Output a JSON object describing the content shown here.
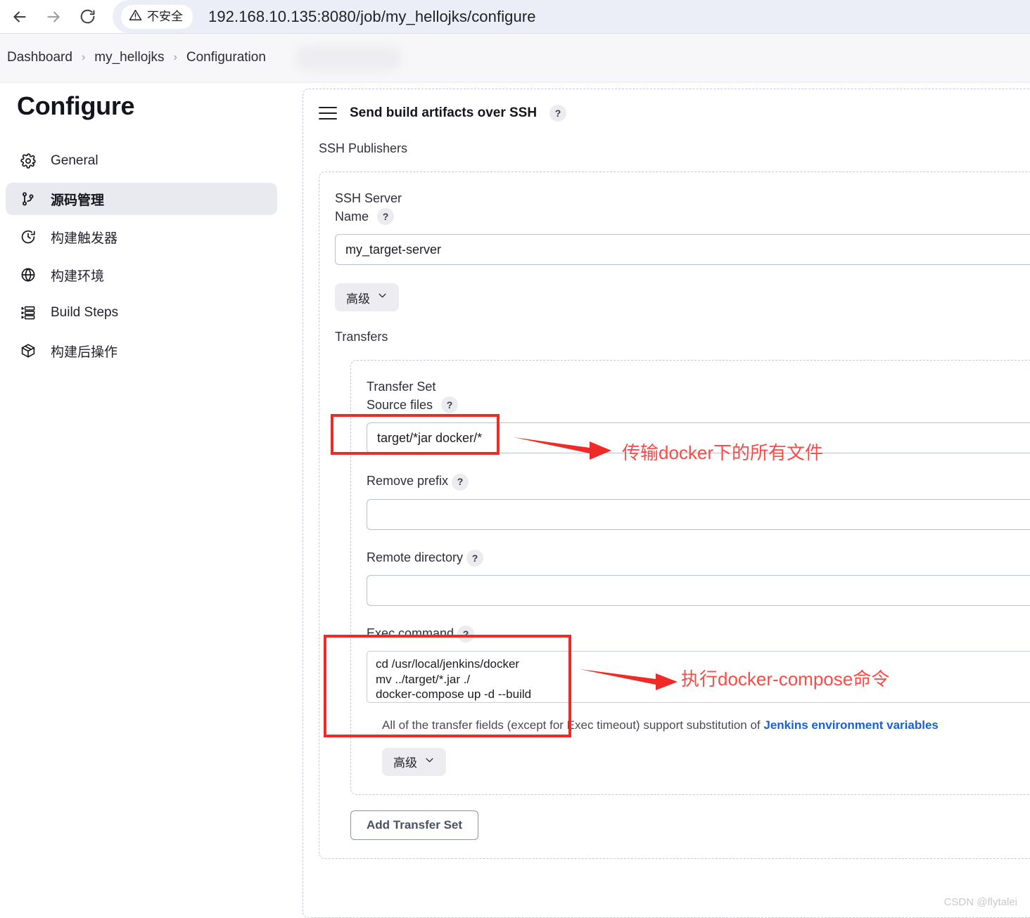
{
  "browser": {
    "back_icon": "arrow-left-icon",
    "forward_icon": "arrow-right-icon",
    "reload_icon": "reload-icon",
    "security_icon": "warning-triangle-icon",
    "security_label": "不安全",
    "url": "192.168.10.135:8080/job/my_hellojks/configure"
  },
  "breadcrumb": {
    "items": [
      {
        "label": "Dashboard"
      },
      {
        "label": "my_hellojks"
      },
      {
        "label": "Configuration"
      }
    ],
    "separator": "›"
  },
  "sidebar": {
    "title": "Configure",
    "items": [
      {
        "label": "General",
        "icon": "gear-icon",
        "selected": false
      },
      {
        "label": "源码管理",
        "icon": "git-branch-icon",
        "selected": true
      },
      {
        "label": "构建触发器",
        "icon": "clock-icon",
        "selected": false
      },
      {
        "label": "构建环境",
        "icon": "globe-icon",
        "selected": false
      },
      {
        "label": "Build Steps",
        "icon": "list-steps-icon",
        "selected": false
      },
      {
        "label": "构建后操作",
        "icon": "package-icon",
        "selected": false
      }
    ]
  },
  "panel": {
    "title": "Send build artifacts over SSH",
    "help_badge": "?",
    "drag_handle_icon": "drag-handle-icon",
    "publishers_label": "SSH Publishers",
    "server": {
      "label_line1": "SSH Server",
      "label_line2": "Name",
      "help_badge": "?",
      "value": "my_target-server",
      "placeholder": ""
    },
    "advanced_top": {
      "label": "高级",
      "chevron_icon": "chevron-down-icon"
    },
    "transfers_label": "Transfers",
    "transfer_set": {
      "label_line1": "Transfer Set",
      "source_files": {
        "label": "Source files",
        "help_badge": "?",
        "value": "target/*jar docker/*",
        "placeholder": ""
      },
      "remove_prefix": {
        "label": "Remove prefix",
        "help_badge": "?",
        "value": "",
        "placeholder": ""
      },
      "remote_directory": {
        "label": "Remote directory",
        "help_badge": "?",
        "value": "",
        "placeholder": ""
      },
      "exec_command": {
        "label": "Exec command",
        "help_badge": "?",
        "value": "cd /usr/local/jenkins/docker\nmv ../target/*.jar ./\ndocker-compose up -d --build",
        "placeholder": ""
      },
      "note_prefix": "All of the transfer fields (except for Exec timeout) support substitution of ",
      "note_link": "Jenkins environment variables",
      "advanced_bottom": {
        "label": "高级",
        "chevron_icon": "chevron-down-icon"
      }
    },
    "add_transfer_set_label": "Add Transfer Set"
  },
  "annotations": [
    {
      "text": "传输docker下的所有文件"
    },
    {
      "text": "执行docker-compose命令"
    }
  ],
  "watermark": "CSDN @flytalei",
  "colors": {
    "annotation_red": "#fb4b47",
    "highlight_box_red": "#ee2b26",
    "link_blue": "#1a5fd4",
    "sidebar_selected_bg": "#e9e9f0",
    "omnibox_bg": "#eceef7"
  }
}
